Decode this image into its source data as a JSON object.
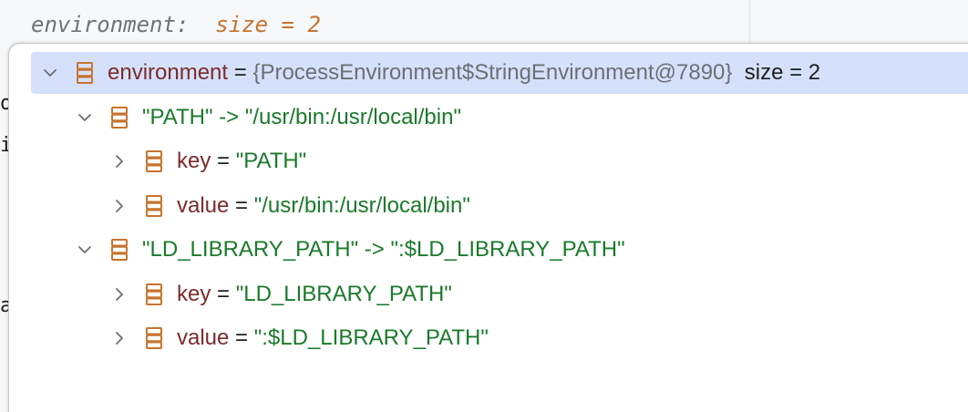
{
  "editor": {
    "inline_hint": {
      "name": "environment:",
      "size": "size = 2"
    },
    "gutter_chars": [
      "o",
      "i",
      "a"
    ]
  },
  "tree": {
    "rows": [
      {
        "level": 0,
        "expanded": true,
        "selected": true,
        "name": "environment",
        "op": " = ",
        "value": "{ProcessEnvironment$StringEnvironment@7890}",
        "extra": "  size = 2"
      },
      {
        "level": 1,
        "expanded": true,
        "selected": false,
        "entry": "\"PATH\" -> \"/usr/bin:/usr/local/bin\""
      },
      {
        "level": 2,
        "expanded": false,
        "selected": false,
        "name": "key",
        "op": " = ",
        "value": "\"PATH\""
      },
      {
        "level": 2,
        "expanded": false,
        "selected": false,
        "name": "value",
        "op": " = ",
        "value": "\"/usr/bin:/usr/local/bin\""
      },
      {
        "level": 1,
        "expanded": true,
        "selected": false,
        "entry": "\"LD_LIBRARY_PATH\" -> \":$LD_LIBRARY_PATH\""
      },
      {
        "level": 2,
        "expanded": false,
        "selected": false,
        "name": "key",
        "op": " = ",
        "value": "\"LD_LIBRARY_PATH\""
      },
      {
        "level": 2,
        "expanded": false,
        "selected": false,
        "name": "value",
        "op": " = ",
        "value": "\":$LD_LIBRARY_PATH\""
      }
    ]
  },
  "icons": {
    "chevron_expanded": "chevron-down-icon",
    "chevron_collapsed": "chevron-right-icon",
    "variable": "variable-field-icon"
  },
  "colors": {
    "selection": "#d5e1fb",
    "name": "#7c2b2b",
    "string": "#1a7a2a",
    "type": "#6b6f75",
    "icon": "#c7732e",
    "hint_size": "#c7732e"
  }
}
